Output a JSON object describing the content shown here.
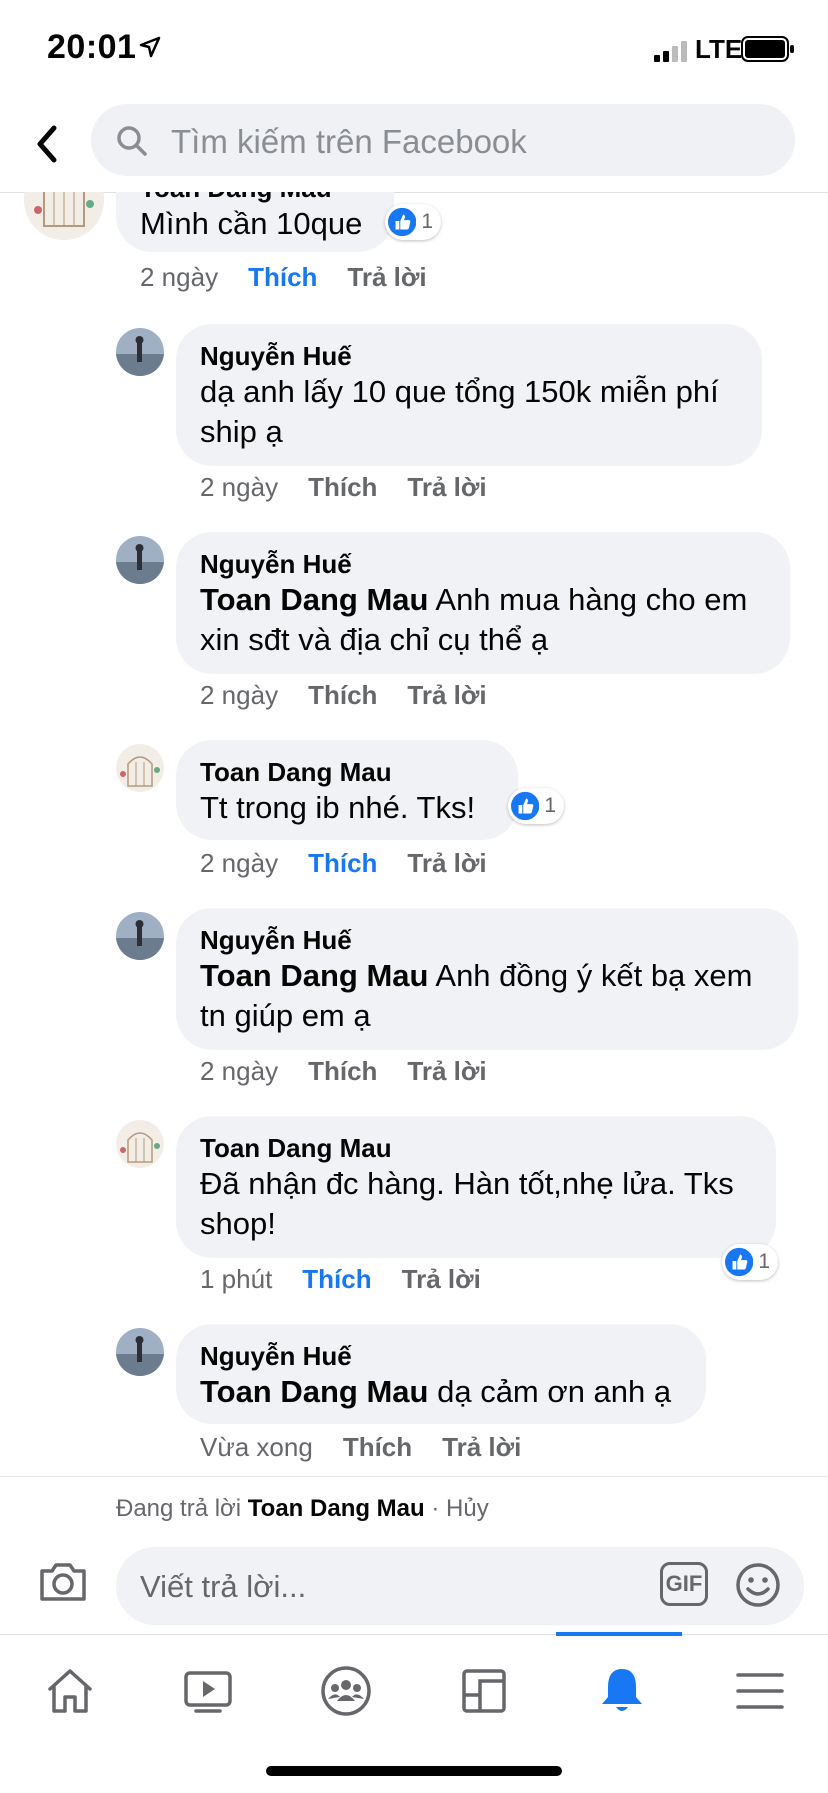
{
  "status_bar": {
    "time": "20:01",
    "network": "LTE"
  },
  "search": {
    "placeholder": "Tìm kiếm trên Facebook"
  },
  "comments": [
    {
      "author": "Toan Dang Mau",
      "mention": "",
      "text": "Mình cần 10que",
      "time": "2 ngày",
      "like": "Thích",
      "reply": "Trả lời",
      "reactions": "1"
    },
    {
      "author": "Nguyễn Huế",
      "mention": "",
      "text": "dạ anh lấy 10 que tổng 150k miễn phí ship ạ",
      "time": "2 ngày",
      "like": "Thích",
      "reply": "Trả lời"
    },
    {
      "author": "Nguyễn Huế",
      "mention": "Toan Dang Mau",
      "text": " Anh mua hàng cho em xin sđt và địa chỉ cụ thể ạ",
      "time": "2 ngày",
      "like": "Thích",
      "reply": "Trả lời"
    },
    {
      "author": "Toan Dang Mau",
      "mention": "",
      "text": "Tt trong ib nhé. Tks!",
      "time": "2 ngày",
      "like": "Thích",
      "reply": "Trả lời",
      "reactions": "1"
    },
    {
      "author": "Nguyễn Huế",
      "mention": "Toan Dang Mau",
      "text": " Anh đồng ý kết bạ xem tn giúp em ạ",
      "time": "2 ngày",
      "like": "Thích",
      "reply": "Trả lời"
    },
    {
      "author": "Toan Dang Mau",
      "mention": "",
      "text": "Đã nhận đc hàng. Hàn tốt,nhẹ lửa. Tks shop!",
      "time": "1 phút",
      "like": "Thích",
      "reply": "Trả lời",
      "reactions": "1"
    },
    {
      "author": "Nguyễn Huế",
      "mention": "Toan Dang Mau",
      "text": " dạ cảm ơn anh ạ",
      "time": "Vừa xong",
      "like": "Thích",
      "reply": "Trả lời"
    }
  ],
  "composer": {
    "replying_prefix": "Đang trả lời ",
    "replying_to": "Toan Dang Mau",
    "cancel": " · Hủy",
    "placeholder": "Viết trả lời...",
    "gif": "GIF"
  },
  "tabs": [
    "home-icon",
    "watch-icon",
    "groups-icon",
    "pages-icon",
    "notifications-icon",
    "menu-icon"
  ],
  "colors": {
    "accent": "#1877f2",
    "bubble": "#f0f2f5",
    "secondary_text": "#65676b"
  }
}
